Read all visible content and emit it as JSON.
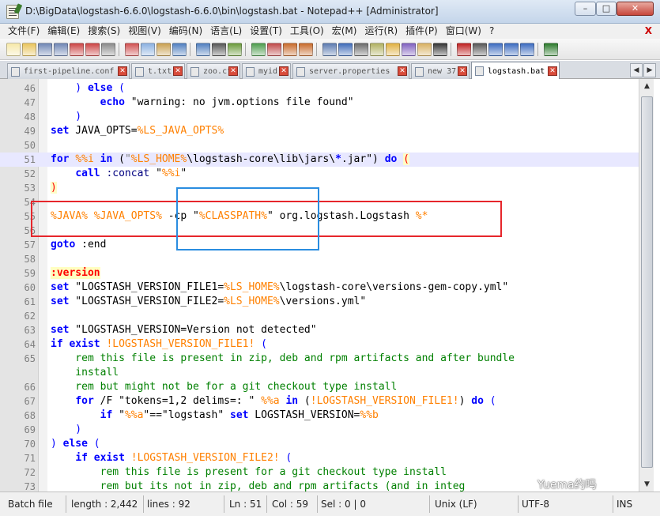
{
  "window": {
    "title": "D:\\BigData\\logstash-6.6.0\\logstash-6.6.0\\bin\\logstash.bat - Notepad++ [Administrator]",
    "icon": "notepad-plus-plus-icon",
    "minimize_glyph": "–",
    "maximize_glyph": "□",
    "close_glyph": "✕"
  },
  "menu": {
    "items": [
      "文件(F)",
      "编辑(E)",
      "搜索(S)",
      "视图(V)",
      "编码(N)",
      "语言(L)",
      "设置(T)",
      "工具(O)",
      "宏(M)",
      "运行(R)",
      "插件(P)",
      "窗口(W)",
      "?"
    ],
    "close_glyph": "X"
  },
  "toolbar": {
    "icons": [
      "new-file-icon",
      "open-file-icon",
      "save-icon",
      "save-all-icon",
      "close-icon",
      "close-all-icon",
      "print-icon",
      "cut-icon",
      "copy-icon",
      "paste-icon",
      "undo-icon",
      "redo-icon",
      "find-icon",
      "replace-icon",
      "zoom-in-icon",
      "zoom-out-icon",
      "sync-vertical-icon",
      "sync-horizontal-icon",
      "word-wrap-icon",
      "show-all-chars-icon",
      "indent-guide-icon",
      "user-language-icon",
      "doc-map-icon",
      "function-list-icon",
      "folder-workspace-icon",
      "monitor-icon",
      "record-macro-icon",
      "stop-macro-icon",
      "play-macro-icon",
      "run-macro-multiple-icon",
      "save-macro-icon",
      "launch-icon"
    ]
  },
  "tabs": [
    {
      "label": "first-pipeline.conf",
      "active": false
    },
    {
      "label": "t.txt",
      "active": false
    },
    {
      "label": "zoo.cfg",
      "active": false
    },
    {
      "label": "myid",
      "active": false
    },
    {
      "label": "server.properties",
      "active": false
    },
    {
      "label": "new 37",
      "active": false
    },
    {
      "label": "logstash.bat",
      "active": true
    }
  ],
  "tab_scroll": {
    "left": "◀",
    "right": "▶"
  },
  "editor": {
    "lines": [
      {
        "n": "46",
        "tokens": [
          [
            "par",
            "    ) "
          ],
          [
            "kw",
            "else"
          ],
          [
            "par",
            " ("
          ]
        ]
      },
      {
        "n": "47",
        "tokens": [
          [
            "cmd",
            "        "
          ],
          [
            "kw",
            "echo"
          ],
          [
            "cmd",
            " \"warning: no jvm.options file found\""
          ]
        ]
      },
      {
        "n": "48",
        "tokens": [
          [
            "par",
            "    )"
          ]
        ]
      },
      {
        "n": "49",
        "tokens": [
          [
            "kw",
            "set"
          ],
          [
            "cmd",
            " JAVA_OPTS="
          ],
          [
            "var",
            "%LS_JAVA_OPTS%"
          ]
        ]
      },
      {
        "n": "50",
        "tokens": [
          [
            "cmd",
            ""
          ]
        ]
      },
      {
        "n": "51",
        "current": true,
        "tokens": [
          [
            "kw",
            "for"
          ],
          [
            "cmd",
            " "
          ],
          [
            "var",
            "%%i"
          ],
          [
            "cmd",
            " "
          ],
          [
            "kw",
            "in"
          ],
          [
            "cmd",
            " ("
          ],
          [
            "str",
            "\""
          ],
          [
            "var",
            "%LS_HOME%"
          ],
          [
            "cmd",
            "\\logstash-core\\lib\\jars\\"
          ],
          [
            "kw",
            "*"
          ],
          [
            "cmd",
            ".jar\") "
          ],
          [
            "kw",
            "do"
          ],
          [
            "cmd",
            " "
          ],
          [
            "lbl",
            "("
          ]
        ]
      },
      {
        "n": "52",
        "tokens": [
          [
            "cmd",
            "    "
          ],
          [
            "kw",
            "call"
          ],
          [
            "cmd",
            " "
          ],
          [
            "op",
            ":concat"
          ],
          [
            "cmd",
            " \""
          ],
          [
            "var",
            "%%i"
          ],
          [
            "cmd",
            "\""
          ]
        ]
      },
      {
        "n": "53",
        "tokens": [
          [
            "lbl",
            ")"
          ]
        ]
      },
      {
        "n": "54",
        "tokens": [
          [
            "cmd",
            ""
          ]
        ]
      },
      {
        "n": "55",
        "tokens": [
          [
            "var",
            "%JAVA%"
          ],
          [
            "cmd",
            " "
          ],
          [
            "var",
            "%JAVA_OPTS%"
          ],
          [
            "cmd",
            " -cp \""
          ],
          [
            "var",
            "%CLASSPATH%"
          ],
          [
            "cmd",
            "\" org.logstash.Logstash "
          ],
          [
            "var",
            "%*"
          ]
        ]
      },
      {
        "n": "56",
        "tokens": [
          [
            "cmd",
            ""
          ]
        ]
      },
      {
        "n": "57",
        "tokens": [
          [
            "kw",
            "goto"
          ],
          [
            "cmd",
            " :end"
          ]
        ]
      },
      {
        "n": "58",
        "tokens": [
          [
            "cmd",
            ""
          ]
        ]
      },
      {
        "n": "59",
        "tokens": [
          [
            "lblhl",
            ":version"
          ]
        ]
      },
      {
        "n": "60",
        "tokens": [
          [
            "kw",
            "set"
          ],
          [
            "cmd",
            " \"LOGSTASH_VERSION_FILE1="
          ],
          [
            "var",
            "%LS_HOME%"
          ],
          [
            "cmd",
            "\\logstash-core\\versions-gem-copy.yml\""
          ]
        ]
      },
      {
        "n": "61",
        "tokens": [
          [
            "kw",
            "set"
          ],
          [
            "cmd",
            " \"LOGSTASH_VERSION_FILE2="
          ],
          [
            "var",
            "%LS_HOME%"
          ],
          [
            "cmd",
            "\\versions.yml\""
          ]
        ]
      },
      {
        "n": "62",
        "tokens": [
          [
            "cmd",
            ""
          ]
        ]
      },
      {
        "n": "63",
        "tokens": [
          [
            "kw",
            "set"
          ],
          [
            "cmd",
            " \"LOGSTASH_VERSION="
          ],
          [
            "cmd",
            "Version not detected\""
          ]
        ]
      },
      {
        "n": "64",
        "tokens": [
          [
            "kw",
            "if"
          ],
          [
            "cmd",
            " "
          ],
          [
            "kw",
            "exist"
          ],
          [
            "cmd",
            " "
          ],
          [
            "var",
            "!LOGSTASH_VERSION_FILE1!"
          ],
          [
            "par",
            " ("
          ]
        ]
      },
      {
        "n": "65",
        "tokens": [
          [
            "rem",
            "    rem this file is present in zip, deb and rpm artifacts and after bundle"
          ]
        ]
      },
      {
        "n": "",
        "tokens": [
          [
            "rem",
            "    install"
          ]
        ]
      },
      {
        "n": "66",
        "tokens": [
          [
            "rem",
            "    rem but might not be for a git checkout type install"
          ]
        ]
      },
      {
        "n": "67",
        "tokens": [
          [
            "cmd",
            "    "
          ],
          [
            "kw",
            "for"
          ],
          [
            "cmd",
            " /F \"tokens=1,2 delims=: \" "
          ],
          [
            "var",
            "%%a"
          ],
          [
            "cmd",
            " "
          ],
          [
            "kw",
            "in"
          ],
          [
            "cmd",
            " ("
          ],
          [
            "var",
            "!LOGSTASH_VERSION_FILE1!"
          ],
          [
            "cmd",
            ") "
          ],
          [
            "kw",
            "do"
          ],
          [
            "par",
            " ("
          ]
        ]
      },
      {
        "n": "68",
        "tokens": [
          [
            "cmd",
            "        "
          ],
          [
            "kw",
            "if"
          ],
          [
            "cmd",
            " \""
          ],
          [
            "var",
            "%%a"
          ],
          [
            "cmd",
            "\"==\"logstash\" "
          ],
          [
            "kw",
            "set"
          ],
          [
            "cmd",
            " LOGSTASH_VERSION="
          ],
          [
            "var",
            "%%b"
          ]
        ]
      },
      {
        "n": "69",
        "tokens": [
          [
            "par",
            "    )"
          ]
        ]
      },
      {
        "n": "70",
        "tokens": [
          [
            "par",
            ") "
          ],
          [
            "kw",
            "else"
          ],
          [
            "par",
            " ("
          ]
        ]
      },
      {
        "n": "71",
        "tokens": [
          [
            "cmd",
            "    "
          ],
          [
            "kw",
            "if"
          ],
          [
            "cmd",
            " "
          ],
          [
            "kw",
            "exist"
          ],
          [
            "cmd",
            " "
          ],
          [
            "var",
            "!LOGSTASH_VERSION_FILE2!"
          ],
          [
            "par",
            " ("
          ]
        ]
      },
      {
        "n": "72",
        "tokens": [
          [
            "rem",
            "        rem this file is present for a git checkout type install"
          ]
        ]
      },
      {
        "n": "73",
        "tokens": [
          [
            "rem",
            "        rem but its not in zip, deb and rpm artifacts (and in integ"
          ]
        ]
      }
    ],
    "scroll_up_glyph": "▲",
    "scroll_down_glyph": "▼"
  },
  "watermark": "Yuema约吗",
  "status": {
    "file_type": "Batch file",
    "length": "length : 2,442",
    "lines": "lines : 92",
    "ln": "Ln : 51",
    "col": "Col : 59",
    "sel": "Sel : 0 | 0",
    "eol": "Unix (LF)",
    "encoding": "UTF-8",
    "mode": "INS"
  },
  "colors": {
    "keyword": "#0000ff",
    "variable": "#ff8000",
    "comment": "#008000",
    "annotation_red": "#e6262b",
    "annotation_blue": "#2a8de0"
  }
}
